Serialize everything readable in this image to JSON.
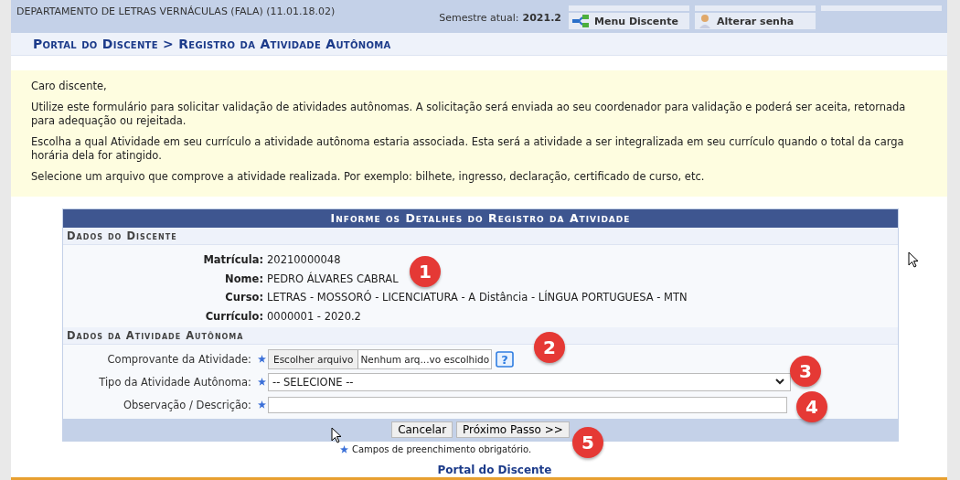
{
  "header": {
    "department": "DEPARTAMENTO DE LETRAS VERNÁCULAS (FALA) (11.01.18.02)",
    "semester_label": "Semestre atual:",
    "semester": "2021.2",
    "shortcuts": [
      {
        "label": "Menu Discente",
        "kind": "tree"
      },
      {
        "label": "Alterar senha",
        "kind": "user"
      }
    ]
  },
  "breadcrumb": "Portal do Discente > Registro da Atividade Autônoma",
  "notice": {
    "greeting": "Caro discente,",
    "paragraphs": [
      "Utilize este formulário para solicitar validação de atividades autônomas. A solicitação será enviada ao seu coordenador para validação e poderá ser aceita, retornada para adequação ou rejeitada.",
      "Escolha a qual Atividade em seu currículo a atividade autônoma estaria associada. Esta será a atividade a ser integralizada em seu currículo quando o total da carga horária dela for atingido.",
      "Selecione um arquivo que comprove a atividade realizada. Por exemplo: bilhete, ingresso, declaração, certificado de curso, etc."
    ]
  },
  "form": {
    "title": "Informe os Detalhes do Registro da Atividade",
    "student_section": "Dados do Discente",
    "student": [
      {
        "label": "Matrícula:",
        "value": "20210000048"
      },
      {
        "label": "Nome:",
        "value": "PEDRO ÁLVARES CABRAL"
      },
      {
        "label": "Curso:",
        "value": "LETRAS - MOSSORÓ - LICENCIATURA - A Distância - LÍNGUA PORTUGUESA - MTN"
      },
      {
        "label": "Currículo:",
        "value": "0000001 - 2020.2"
      }
    ],
    "activity_section": "Dados da Atividade Autônoma",
    "fields": [
      {
        "label": "Comprovante da Atividade:",
        "kind": "file",
        "button": "Escolher arquivo",
        "value": "Nenhum arq...vo escolhido",
        "help": "?",
        "required": true
      },
      {
        "label": "Tipo da Atividade Autônoma:",
        "kind": "select",
        "value": "-- SELECIONE --",
        "required": true
      },
      {
        "label": "Observação / Descrição:",
        "kind": "text",
        "required": true
      }
    ],
    "buttons": [
      "Cancelar",
      "Próximo Passo >>"
    ],
    "required_note": "Campos de preenchimento obrigatório."
  },
  "footer_link": "Portal do Discente",
  "markers": [
    "1",
    "2",
    "3",
    "4",
    "5"
  ]
}
